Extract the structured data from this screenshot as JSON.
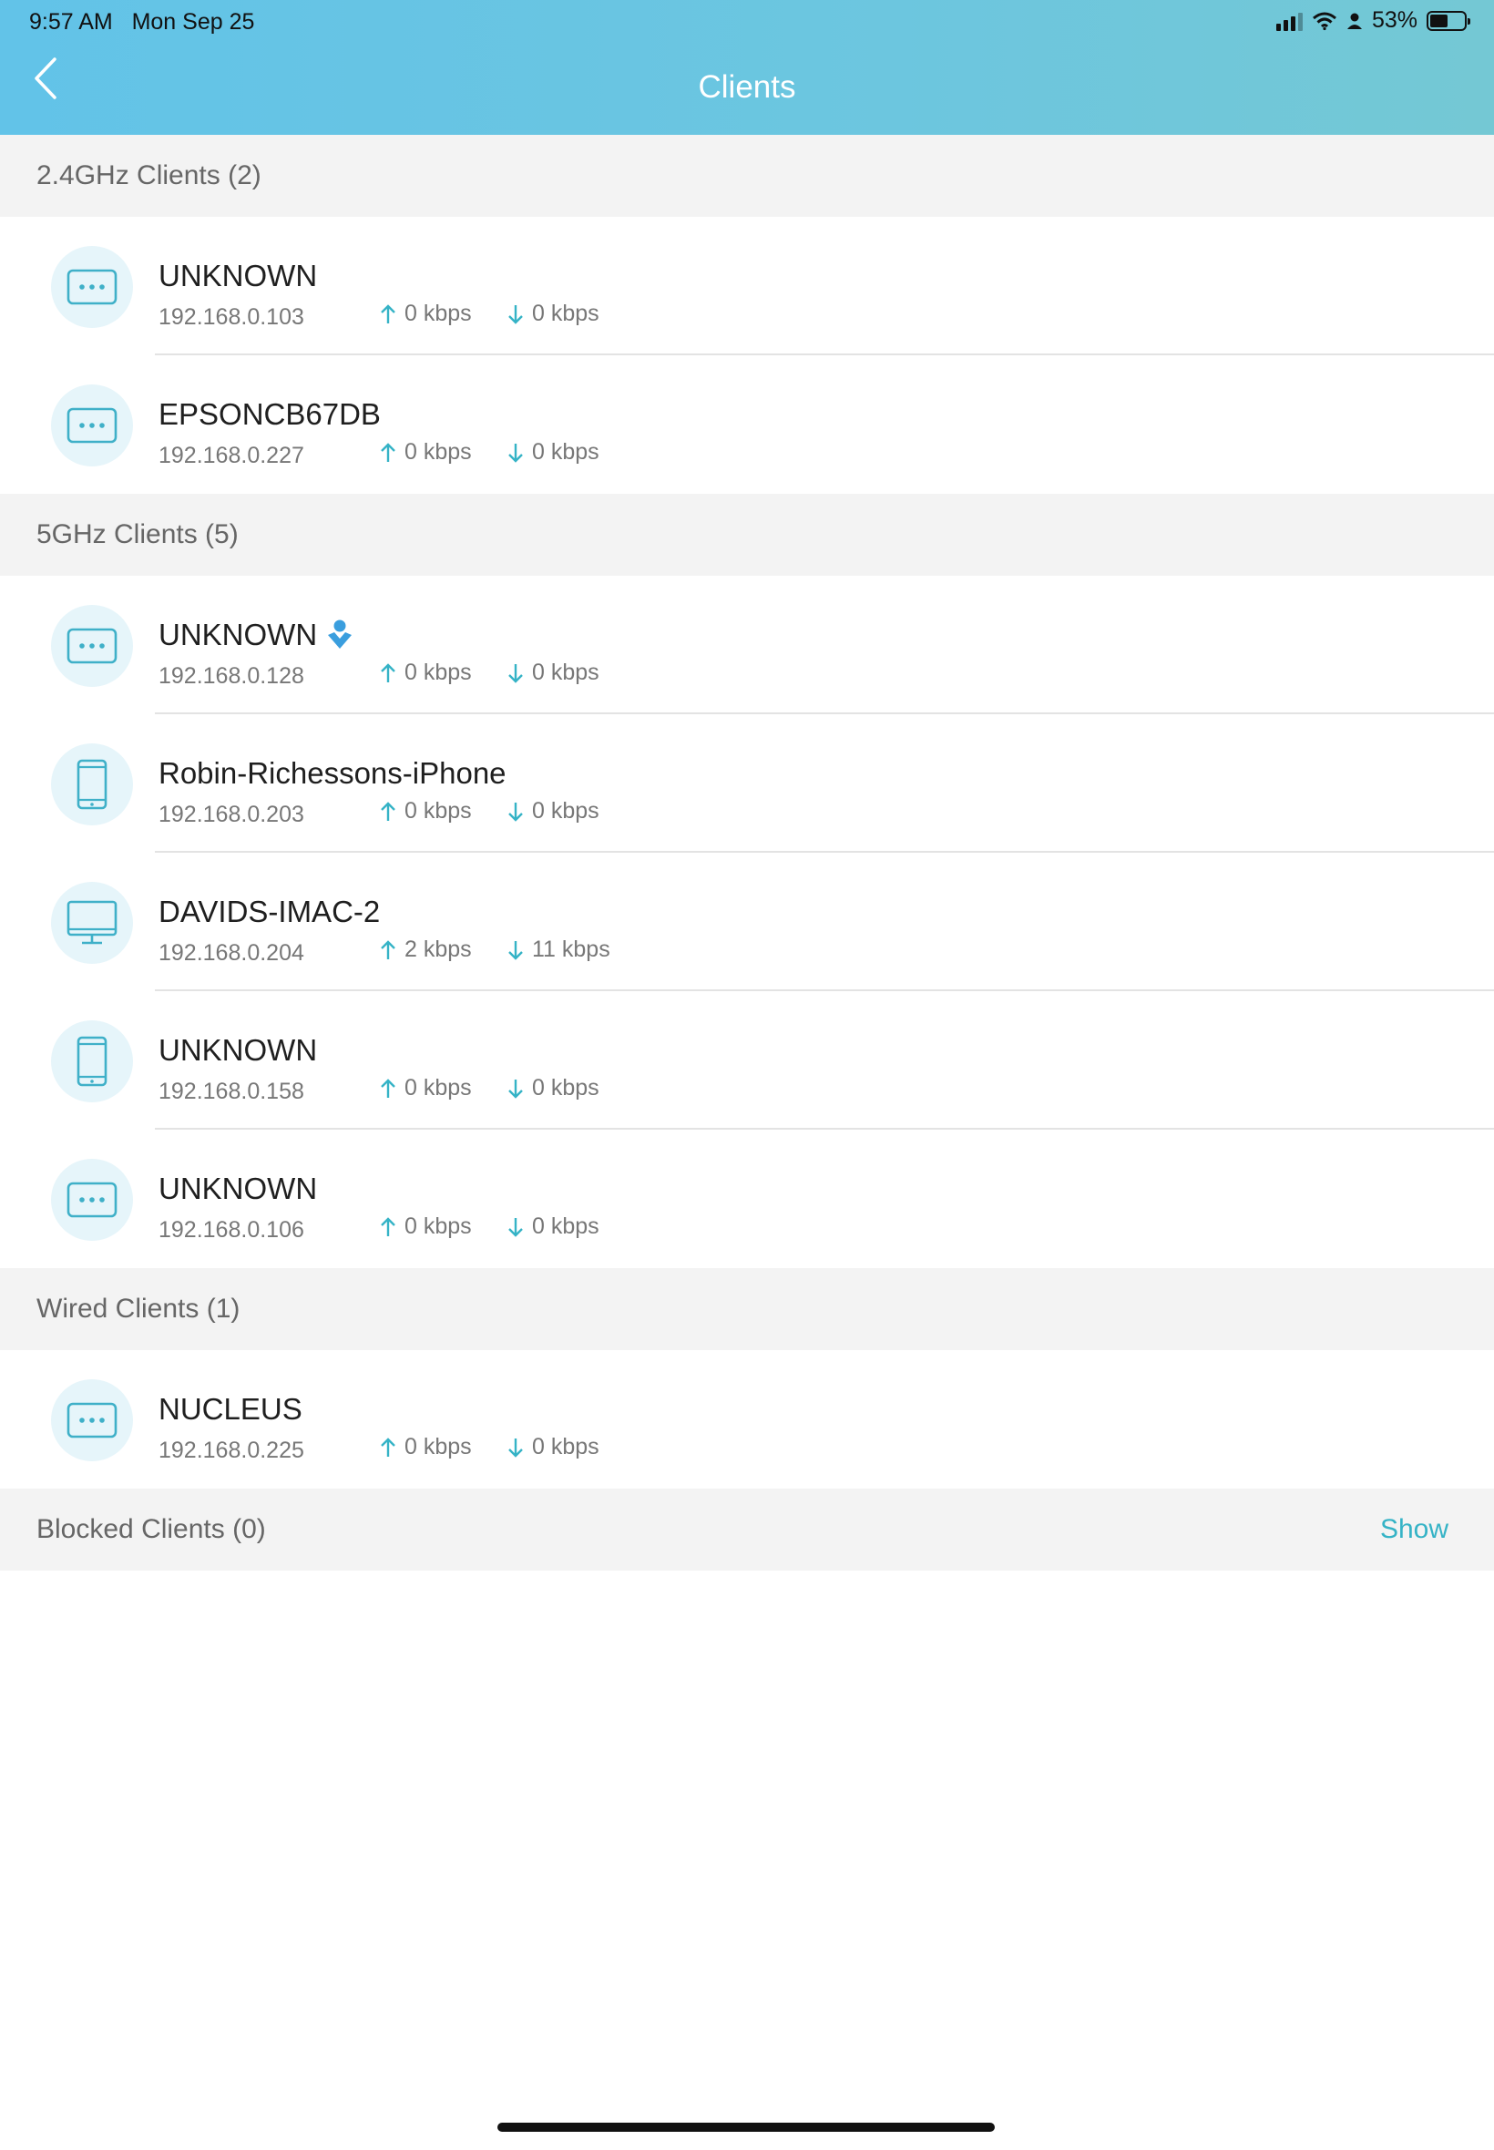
{
  "status_bar": {
    "time": "9:57 AM",
    "date": "Mon Sep 25",
    "battery": "53%",
    "battery_level": 0.53
  },
  "nav": {
    "title": "Clients",
    "back_icon": "chevron-left-icon"
  },
  "sections": {
    "band24": {
      "title": "2.4GHz Clients (2)"
    },
    "band5": {
      "title": "5GHz Clients (5)"
    },
    "wired": {
      "title": "Wired Clients (1)"
    },
    "blocked": {
      "title": "Blocked Clients (0)",
      "action": "Show"
    }
  },
  "clients": [
    {
      "name": "UNKNOWN",
      "ip": "192.168.0.103",
      "up": "0 kbps",
      "down": "0 kbps",
      "icon": "generic-device-icon"
    },
    {
      "name": "EPSONCB67DB",
      "ip": "192.168.0.227",
      "up": "0 kbps",
      "down": "0 kbps",
      "icon": "generic-device-icon"
    },
    {
      "name": "UNKNOWN",
      "ip": "192.168.0.128",
      "up": "0 kbps",
      "down": "0 kbps",
      "icon": "generic-device-icon",
      "badge_icon": "family-profile-icon"
    },
    {
      "name": "Robin-Richessons-iPhone",
      "ip": "192.168.0.203",
      "up": "0 kbps",
      "down": "0 kbps",
      "icon": "phone-icon"
    },
    {
      "name": "DAVIDS-IMAC-2",
      "ip": "192.168.0.204",
      "up": "2 kbps",
      "down": "11 kbps",
      "icon": "desktop-icon"
    },
    {
      "name": "UNKNOWN",
      "ip": "192.168.0.158",
      "up": "0 kbps",
      "down": "0 kbps",
      "icon": "phone-icon"
    },
    {
      "name": "UNKNOWN",
      "ip": "192.168.0.106",
      "up": "0 kbps",
      "down": "0 kbps",
      "icon": "generic-device-icon"
    },
    {
      "name": "NUCLEUS",
      "ip": "192.168.0.225",
      "up": "0 kbps",
      "down": "0 kbps",
      "icon": "generic-device-icon"
    }
  ],
  "colors": {
    "header_start": "#62c3e8",
    "header_end": "#74c8d4",
    "accent": "#35b3c6",
    "icon_bg": "#e6f5fa",
    "section_bg": "#f3f3f3"
  }
}
